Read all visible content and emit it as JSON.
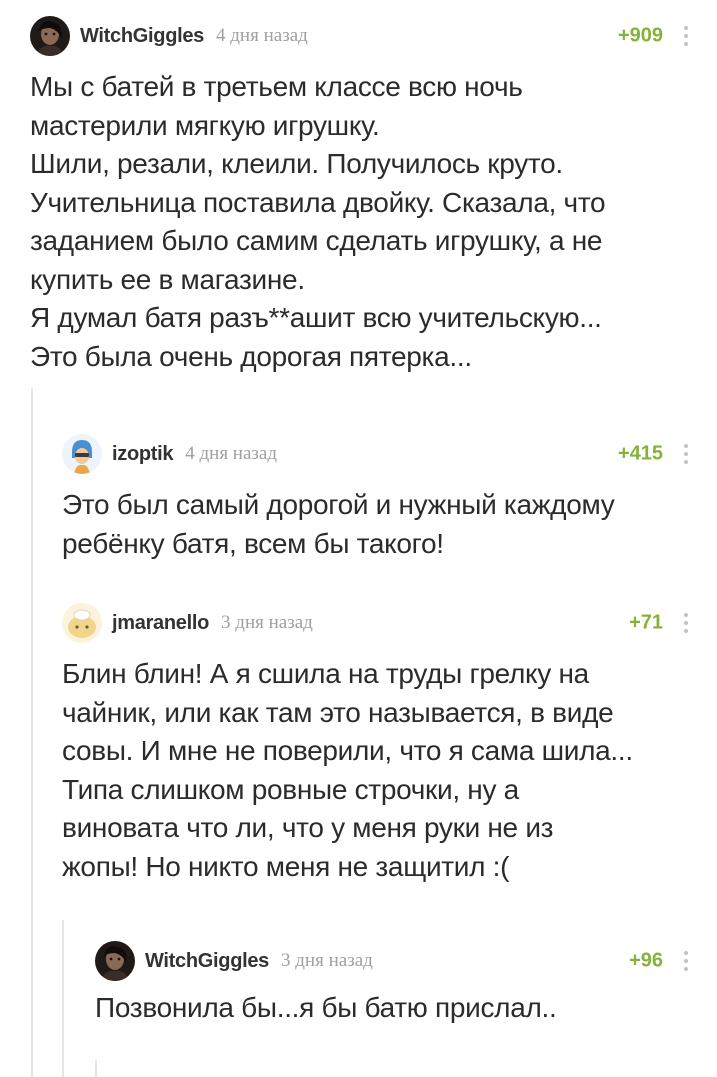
{
  "comments": [
    {
      "username": "WitchGiggles",
      "timestamp": "4 дня назад",
      "rating": "+909",
      "avatar_icon": "user-avatar-icon",
      "text": "Мы с батей в третьем классе всю ночь\nмастерили мягкую игрушку.\nШили, резали, клеили. Получилось круто.\nУчительница поставила двойку. Сказала, что\nзаданием было самим сделать игрушку, а не\nкупить ее в магазине.\nЯ думал батя разъ**ашит всю учительскую...\nЭто была очень дорогая пятерка..."
    },
    {
      "username": "izoptik",
      "timestamp": "4 дня назад",
      "rating": "+415",
      "avatar_icon": "user-avatar-icon",
      "text": "Это был самый дорогой и нужный каждому\nребёнку батя, всем бы такого!"
    },
    {
      "username": "jmaranello",
      "timestamp": "3 дня назад",
      "rating": "+71",
      "avatar_icon": "user-avatar-icon",
      "text": "Блин блин! А я сшила на труды грелку на\nчайник, или как там это называется, в виде\nсовы. И мне не поверили, что я сама шила...\nТипа слишком ровные строчки, ну а\nвиновата что ли, что у меня руки не из\nжопы! Но никто меня не защитил :("
    },
    {
      "username": "WitchGiggles",
      "timestamp": "3 дня назад",
      "rating": "+96",
      "avatar_icon": "user-avatar-icon",
      "text": "Позвонила бы...я бы батю прислал.."
    }
  ],
  "colors": {
    "rating": "#87b23a",
    "username": "#333333",
    "timestamp": "#a0a0a0",
    "text": "#2b2b2b",
    "thread_line": "#e6e6e6"
  }
}
